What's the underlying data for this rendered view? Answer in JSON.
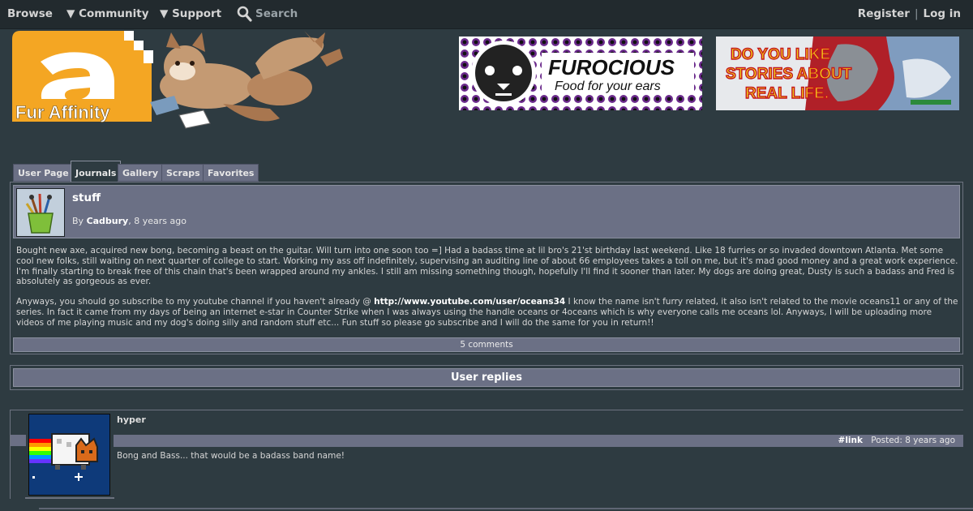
{
  "nav": {
    "browse": "Browse",
    "community": "▼ Community",
    "support": "▼ Support",
    "search": "Search",
    "register": "Register",
    "separator": "|",
    "login": "Log in"
  },
  "logo": {
    "text": "Fur Affinity",
    "letter": "a"
  },
  "banners": {
    "furocious_title": "FUROCIOUS",
    "furocious_tagline": "Food for your ears",
    "stories_line1": "DO YOU LIKE",
    "stories_line2": "STORIES ABOUT",
    "stories_line3": "REAL LIFE."
  },
  "tabs": {
    "user_page": "User Page",
    "journals": "Journals",
    "gallery": "Gallery",
    "scraps": "Scraps",
    "favorites": "Favorites"
  },
  "journal": {
    "title": "stuff",
    "by_prefix": "By ",
    "author": "Cadbury",
    "time": ", 8 years ago",
    "paragraph1": "Bought new axe, acquired new bong, becoming a beast on the guitar. Will turn into one soon too =] Had a badass time at lil bro's 21'st birthday last weekend. Like 18 furries or so invaded downtown Atlanta. Met some cool new folks, still waiting on next quarter of college to start. Working my ass off indefinitely, supervising an auditing line of about 66 employees takes a toll on me, but it's mad good money and a great work experience. I'm finally starting to break free of this chain that's been wrapped around my ankles. I still am missing something though, hopefully I'll find it sooner than later. My dogs are doing great, Dusty is such a badass and Fred is absolutely as gorgeous as ever.",
    "paragraph2_start": "Anyways, you should go subscribe to my youtube channel if you haven't already @ ",
    "paragraph2_link": "http://www.youtube.com/user/oceans34",
    "paragraph2_end": " I know the name isn't furry related, it also isn't related to the movie oceans11 or any of the series. In fact it came from my days of being an internet e-star in Counter Strike when I was always using the handle oceans or 4oceans which is why everyone calls me oceans lol. Anyways, I will be uploading more videos of me playing music and my dog's doing silly and random stuff etc... Fun stuff so please go subscribe and I will do the same for you in return!!",
    "comments_count": "5 comments"
  },
  "replies": {
    "header": "User replies"
  },
  "comment": {
    "username": "hyper",
    "link": "#link",
    "posted": "Posted: 8 years ago",
    "text": "Bong and Bass... that would be a badass band name!"
  },
  "colors": {
    "background": "#2e3b41",
    "navbar": "#222a2e",
    "panel": "#6b7085",
    "logo_orange": "#f4a623"
  }
}
